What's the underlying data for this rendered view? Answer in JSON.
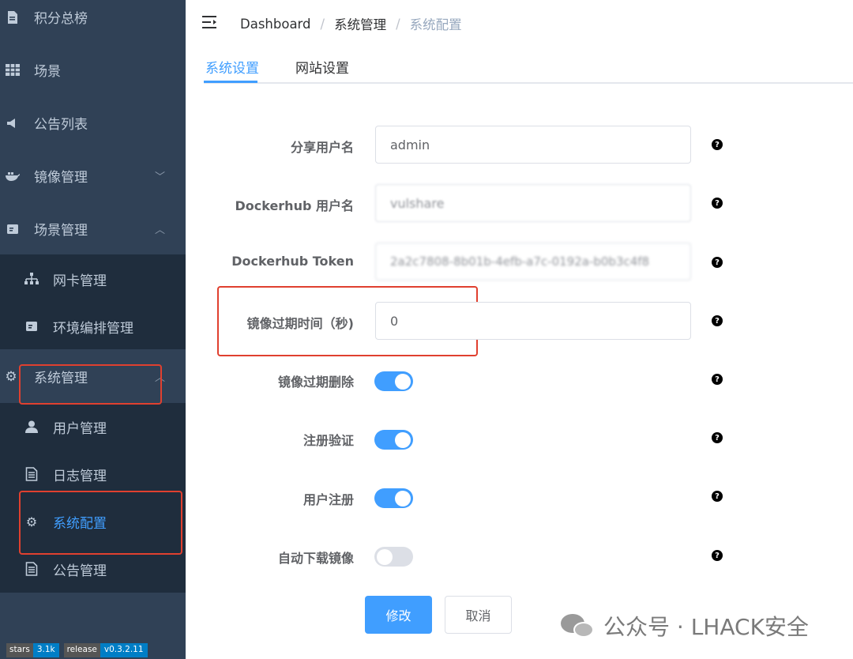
{
  "sidebar": {
    "items": [
      {
        "label": "积分总榜",
        "icon": "document-icon"
      },
      {
        "label": "场景",
        "icon": "table-icon"
      },
      {
        "label": "公告列表",
        "icon": "megaphone-icon"
      },
      {
        "label": "镜像管理",
        "icon": "docker-icon"
      },
      {
        "label": "场景管理",
        "icon": "card-icon"
      }
    ],
    "scene_sub": [
      {
        "label": "网卡管理",
        "icon": "network-icon"
      },
      {
        "label": "环境编排管理",
        "icon": "card-icon"
      }
    ],
    "system": {
      "label": "系统管理",
      "icon": "gear-icon"
    },
    "system_sub": [
      {
        "label": "用户管理",
        "icon": "user-icon"
      },
      {
        "label": "日志管理",
        "icon": "document-icon"
      },
      {
        "label": "系统配置",
        "icon": "gear-icon"
      },
      {
        "label": "公告管理",
        "icon": "document-icon"
      }
    ],
    "badges": [
      {
        "key": "stars",
        "value": "3.1k"
      },
      {
        "key": "release",
        "value": "v0.3.2.11"
      }
    ]
  },
  "header": {
    "breadcrumb": [
      "Dashboard",
      "系统管理",
      "系统配置"
    ],
    "separator": "/"
  },
  "tabs": [
    "系统设置",
    "网站设置"
  ],
  "form": {
    "share_user_label": "分享用户名",
    "share_user_value": "admin",
    "docker_user_label": "Dockerhub 用户名",
    "docker_user_value": "vulshare",
    "docker_token_label": "Dockerhub Token",
    "docker_token_value": "2a2c7808-8b01b-4efb-a7c-0192a-b0b3c4f8",
    "expire_time_label": "镜像过期时间（秒)",
    "expire_time_value": "0",
    "expire_delete_label": "镜像过期删除",
    "expire_delete_on": true,
    "register_verify_label": "注册验证",
    "register_verify_on": true,
    "user_register_label": "用户注册",
    "user_register_on": true,
    "auto_download_label": "自动下载镜像",
    "auto_download_on": false,
    "help_glyph": "?"
  },
  "buttons": {
    "submit": "修改",
    "cancel": "取消"
  },
  "watermark": {
    "text": "公众号 · LHACK安全"
  },
  "colors": {
    "sidebar_bg": "#304156",
    "submenu_bg": "#1f2d3d",
    "accent": "#409eff",
    "highlight_box": "#e0402f"
  }
}
